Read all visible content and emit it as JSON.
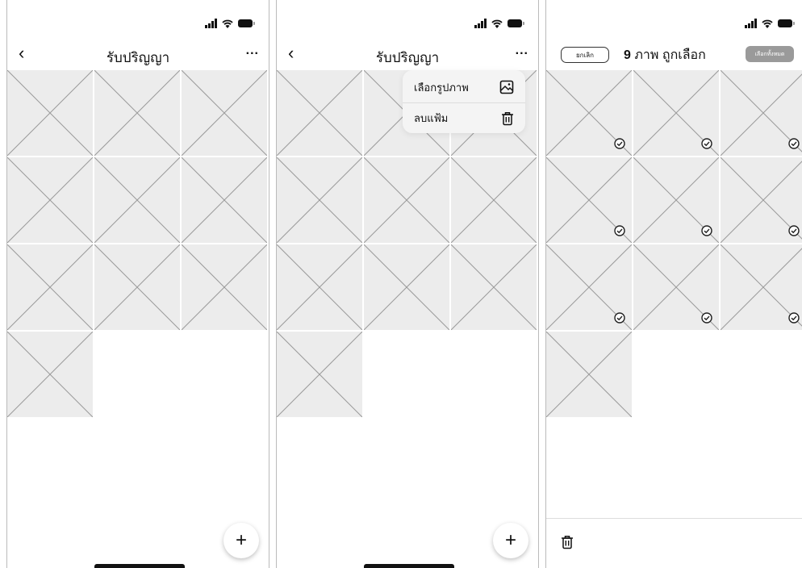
{
  "screen1": {
    "title": "รับปริญญา",
    "back_icon": "chevron-left-icon",
    "more_label": "...",
    "fab_label": "+"
  },
  "screen2": {
    "title": "รับปริญญา",
    "more_label": "...",
    "menu": [
      {
        "label": "เลือกรูปภาพ",
        "icon": "image-icon"
      },
      {
        "label": "ลบแฟ้ม",
        "icon": "trash-icon"
      }
    ],
    "fab_label": "+"
  },
  "screen3": {
    "cancel_label": "ยกเลิก",
    "count": "9",
    "title_suffix": "ภาพ ถูกเลือก",
    "select_all_label": "เลือกทั้งหมด",
    "trash_icon": "trash-icon"
  }
}
